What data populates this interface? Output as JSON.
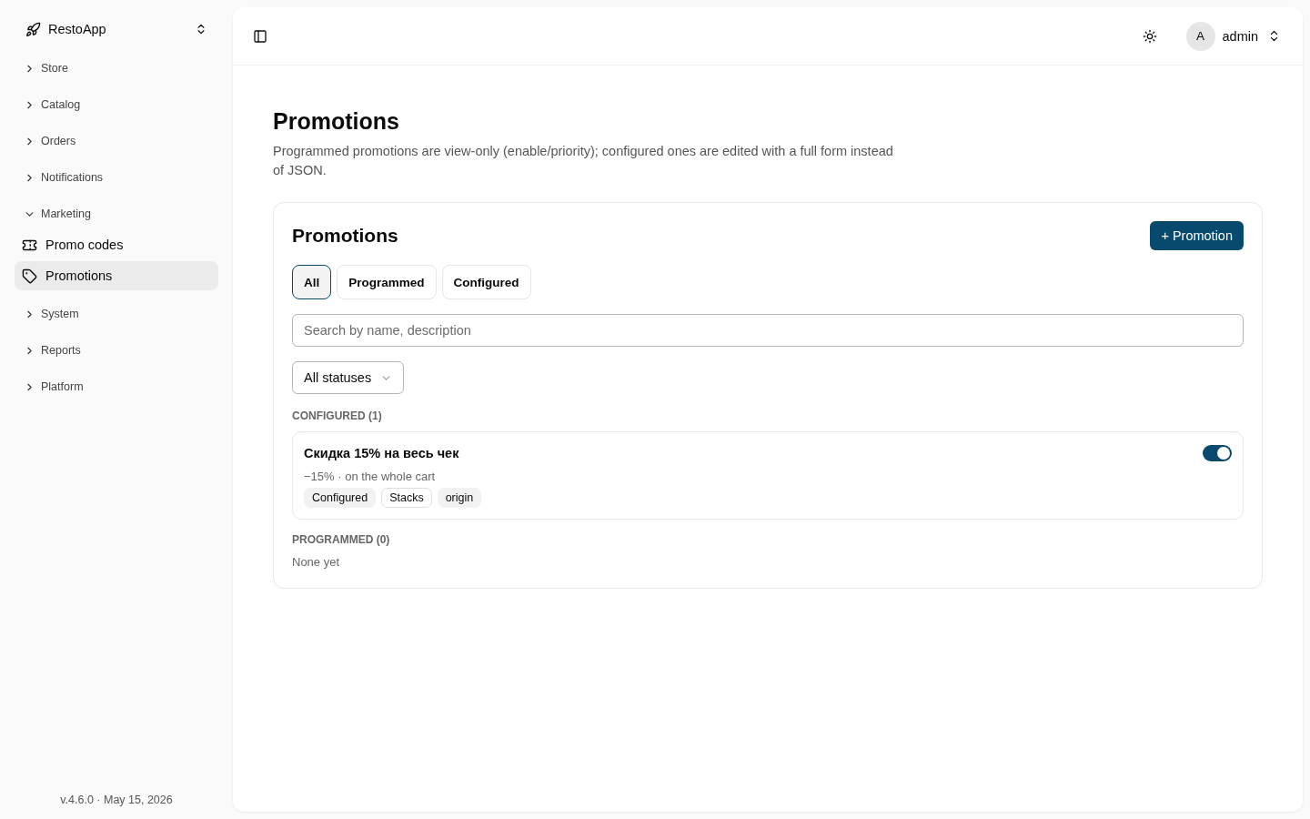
{
  "sidebar": {
    "brand": "RestoApp",
    "items": [
      {
        "label": "Store",
        "expanded": false
      },
      {
        "label": "Catalog",
        "expanded": false
      },
      {
        "label": "Orders",
        "expanded": false
      },
      {
        "label": "Notifications",
        "expanded": false
      },
      {
        "label": "Marketing",
        "expanded": true,
        "children": [
          {
            "label": "Promo codes",
            "selected": false
          },
          {
            "label": "Promotions",
            "selected": true
          }
        ]
      },
      {
        "label": "System",
        "expanded": false
      },
      {
        "label": "Reports",
        "expanded": false
      },
      {
        "label": "Platform",
        "expanded": false
      }
    ],
    "footer": "v.4.6.0 · May 15, 2026"
  },
  "header": {
    "user": {
      "initial": "A",
      "name": "admin"
    }
  },
  "page": {
    "title": "Promotions",
    "description": "Programmed promotions are view-only (enable/priority); configured ones are edited with a full form instead of JSON."
  },
  "card": {
    "title": "Promotions",
    "add_button": "+ Promotion",
    "tabs": [
      {
        "label": "All",
        "selected": true
      },
      {
        "label": "Programmed",
        "selected": false
      },
      {
        "label": "Configured",
        "selected": false
      }
    ],
    "search": {
      "placeholder": "Search by name, description"
    },
    "status_filter": {
      "value": "All statuses"
    },
    "sections": [
      {
        "heading": "CONFIGURED (1)",
        "items": [
          {
            "name": "Скидка 15% на весь чек",
            "summary": "−15% · on the whole cart",
            "on": true,
            "tags": [
              {
                "label": "Configured",
                "kind": "filled"
              },
              {
                "label": "Stacks",
                "kind": "outline"
              },
              {
                "label": "origin",
                "kind": "filled"
              }
            ]
          }
        ]
      },
      {
        "heading": "PROGRAMMED (0)",
        "empty_text": "None yet"
      }
    ]
  }
}
